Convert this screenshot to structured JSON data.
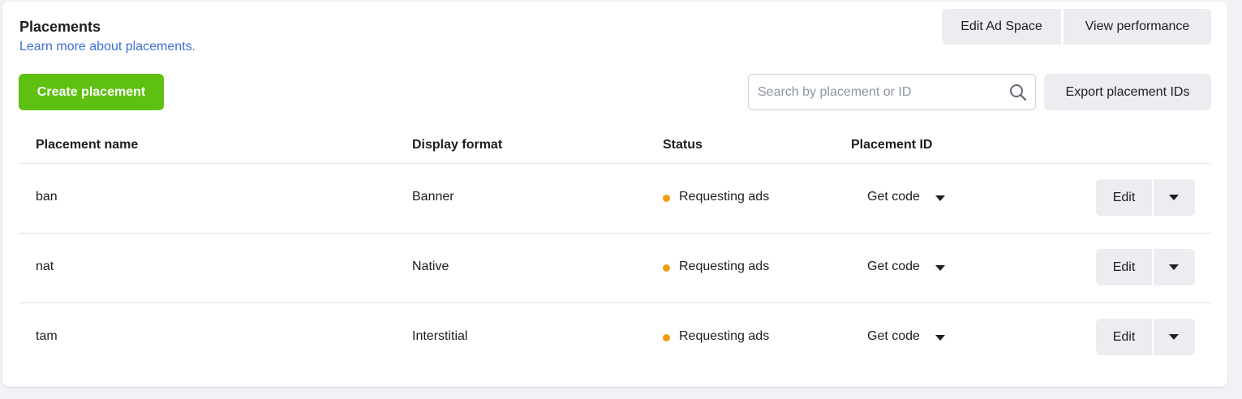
{
  "header": {
    "title": "Placements",
    "learn_more": "Learn more about placements.",
    "edit_ad_space": "Edit Ad Space",
    "view_performance": "View performance"
  },
  "toolbar": {
    "create_placement": "Create placement",
    "search_placeholder": "Search by placement or ID",
    "search_value": "",
    "export_ids": "Export placement IDs"
  },
  "table": {
    "columns": [
      "Placement name",
      "Display format",
      "Status",
      "Placement ID"
    ],
    "rows": [
      {
        "name": "ban",
        "format": "Banner",
        "status": "Requesting ads",
        "id_action": "Get code",
        "edit": "Edit"
      },
      {
        "name": "nat",
        "format": "Native",
        "status": "Requesting ads",
        "id_action": "Get code",
        "edit": "Edit"
      },
      {
        "name": "tam",
        "format": "Interstitial",
        "status": "Requesting ads",
        "id_action": "Get code",
        "edit": "Edit"
      }
    ]
  },
  "colors": {
    "accent_green": "#5ec010",
    "link_blue": "#3b6fd4",
    "status_orange": "#f39c12",
    "button_gray": "#ebedf0"
  },
  "icons": {
    "search": "search-icon",
    "dropdown": "caret-down-icon",
    "status": "status-dot-icon"
  }
}
